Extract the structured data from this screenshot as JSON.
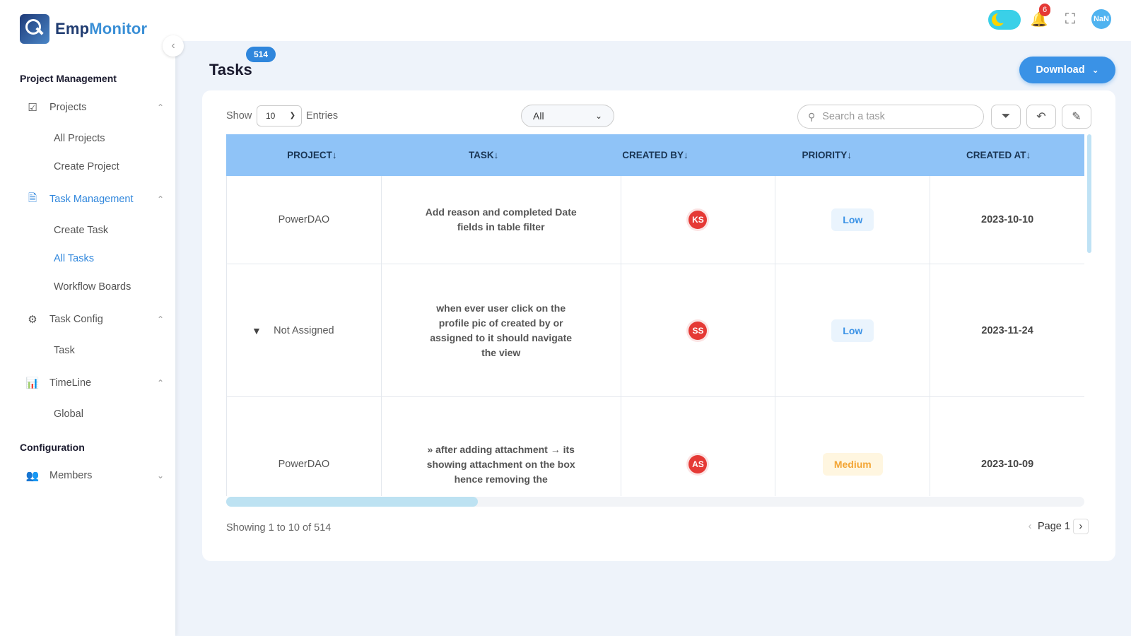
{
  "brand": {
    "name_a": "Emp",
    "name_b": "Monitor"
  },
  "sidebar": {
    "section1": "Project Management",
    "projects": {
      "label": "Projects",
      "subs": [
        "All Projects",
        "Create Project"
      ]
    },
    "task_management": {
      "label": "Task Management",
      "subs": [
        "Create Task",
        "All Tasks",
        "Workflow Boards"
      ]
    },
    "task_config": {
      "label": "Task Config",
      "subs": [
        "Task"
      ]
    },
    "timeline": {
      "label": "TimeLine",
      "subs": [
        "Global"
      ]
    },
    "section2": "Configuration",
    "members": {
      "label": "Members"
    }
  },
  "topbar": {
    "notification_count": "6",
    "avatar_text": "NaN"
  },
  "header": {
    "title": "Tasks",
    "count": "514",
    "download_label": "Download"
  },
  "controls": {
    "show_label": "Show",
    "entries_value": "10",
    "entries_label": "Entries",
    "filter_value": "All",
    "search_placeholder": "Search a task"
  },
  "table": {
    "columns": [
      "PROJECT↓",
      "TASK↓",
      "CREATED BY↓",
      "PRIORITY↓",
      "CREATED AT↓"
    ],
    "rows": [
      {
        "project": "PowerDAO",
        "task": "Add reason and completed Date fields in table filter",
        "created_by": "KS",
        "priority": "Low",
        "created_at": "2023-10-10"
      },
      {
        "project": "Not Assigned",
        "task": "when ever user click on the profile pic of created by or assigned to it should navigate the view",
        "created_by": "SS",
        "priority": "Low",
        "created_at": "2023-11-24"
      },
      {
        "project": "PowerDAO",
        "task": "» after adding attachment → its showing attachment on the box hence removing the",
        "created_by": "AS",
        "priority": "Medium",
        "created_at": "2023-10-09"
      }
    ]
  },
  "footer": {
    "showing": "Showing 1 to 10 of 514",
    "page": "Page 1"
  },
  "colors": {
    "accent": "#2f86dc",
    "header_bg": "#8fc3f7",
    "avatar": "#e53935"
  }
}
